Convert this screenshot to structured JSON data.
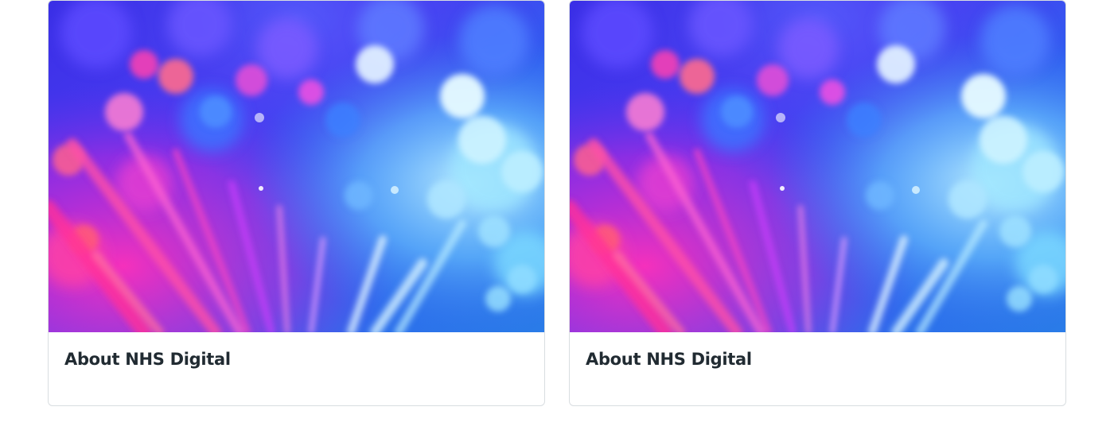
{
  "cards": [
    {
      "title": "About NHS Digital",
      "image_description": "fibre-optic-bokeh-image"
    },
    {
      "title": "About NHS Digital",
      "image_description": "fibre-optic-bokeh-image"
    }
  ],
  "colors": {
    "title_text": "#212b32",
    "card_border": "#d8dde0",
    "image_base_blue": "#2f3cf0",
    "image_magenta": "#e021c8",
    "image_cyan": "#a9e7ff"
  }
}
